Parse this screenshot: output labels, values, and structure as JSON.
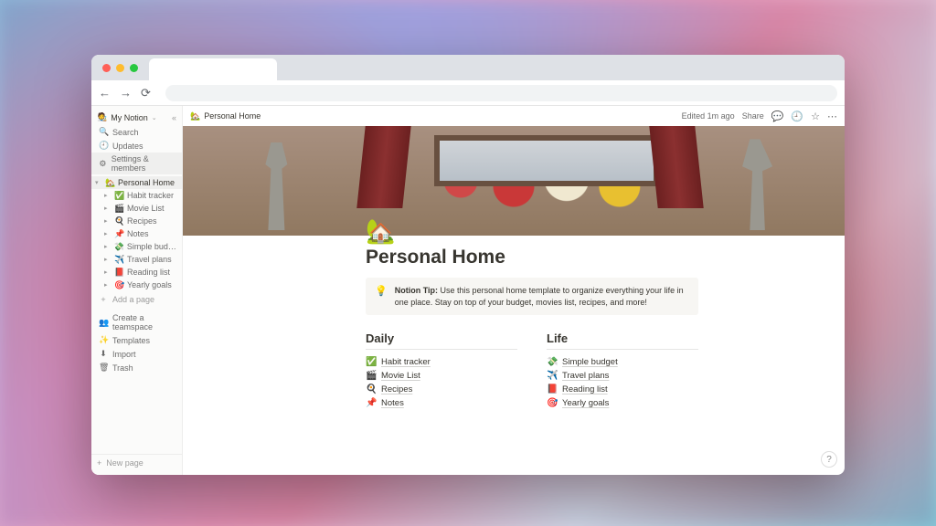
{
  "workspace": {
    "name": "My Notion",
    "emoji": "🧑‍🎨"
  },
  "sidebar": {
    "search": "Search",
    "updates": "Updates",
    "settings": "Settings & members",
    "add_page": "Add a page",
    "create_teamspace": "Create a teamspace",
    "templates": "Templates",
    "import": "Import",
    "trash": "Trash",
    "new_page": "New page",
    "tree": {
      "root": {
        "emoji": "🏡",
        "label": "Personal Home"
      },
      "children": [
        {
          "emoji": "✅",
          "label": "Habit tracker"
        },
        {
          "emoji": "🎬",
          "label": "Movie List"
        },
        {
          "emoji": "🍳",
          "label": "Recipes"
        },
        {
          "emoji": "📌",
          "label": "Notes"
        },
        {
          "emoji": "💸",
          "label": "Simple budget"
        },
        {
          "emoji": "✈️",
          "label": "Travel plans"
        },
        {
          "emoji": "📕",
          "label": "Reading list"
        },
        {
          "emoji": "🎯",
          "label": "Yearly goals"
        }
      ]
    }
  },
  "topbar": {
    "breadcrumb_emoji": "🏡",
    "breadcrumb": "Personal Home",
    "edited": "Edited 1m ago",
    "share": "Share"
  },
  "page": {
    "icon": "🏡",
    "title": "Personal Home",
    "callout_icon": "💡",
    "callout_label": "Notion Tip:",
    "callout_text": "Use this personal home template to organize everything your life in one place. Stay on top of your budget, movies list, recipes, and more!",
    "columns": [
      {
        "heading": "Daily",
        "links": [
          {
            "emoji": "✅",
            "label": "Habit tracker"
          },
          {
            "emoji": "🎬",
            "label": "Movie List"
          },
          {
            "emoji": "🍳",
            "label": "Recipes"
          },
          {
            "emoji": "📌",
            "label": "Notes"
          }
        ]
      },
      {
        "heading": "Life",
        "links": [
          {
            "emoji": "💸",
            "label": "Simple budget"
          },
          {
            "emoji": "✈️",
            "label": "Travel plans"
          },
          {
            "emoji": "📕",
            "label": "Reading list"
          },
          {
            "emoji": "🎯",
            "label": "Yearly goals"
          }
        ]
      }
    ]
  },
  "help": "?"
}
